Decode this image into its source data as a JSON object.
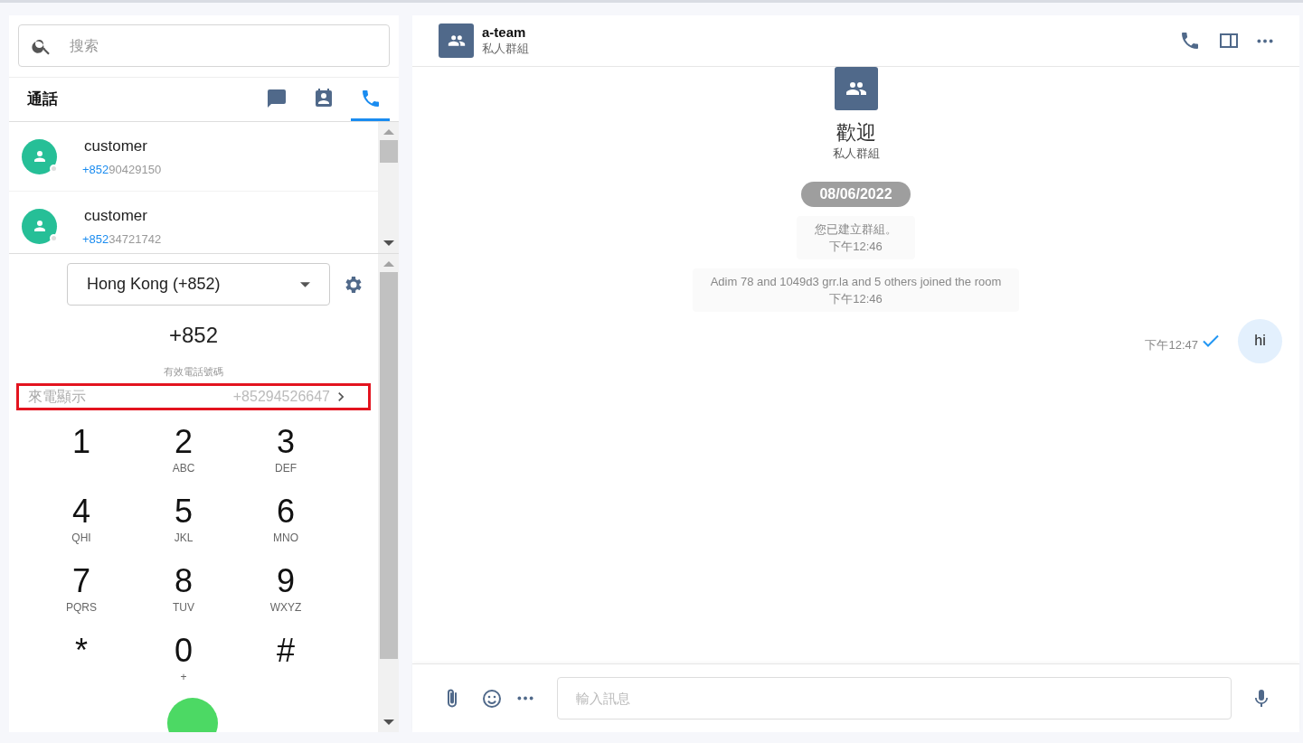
{
  "sidebar": {
    "search": {
      "placeholder": "搜索"
    },
    "title": "通話",
    "tabs": [
      {
        "kind": "chats",
        "selected": false
      },
      {
        "kind": "contacts",
        "selected": false
      },
      {
        "kind": "calls",
        "selected": true
      }
    ],
    "calls": [
      {
        "name": "customer",
        "code": "+852",
        "number": "90429150",
        "online": false
      },
      {
        "name": "customer",
        "code": "+852",
        "number": "34721742",
        "online": false
      }
    ],
    "dialer": {
      "country": "Hong Kong (+852)",
      "entered": "+852",
      "hint": "有效電話號碼",
      "caller_id": {
        "label": "來電顯示",
        "value": "+85294526647",
        "highlighted": true
      },
      "keys": [
        {
          "digit": "1"
        },
        {
          "digit": "2",
          "letters": "ABC"
        },
        {
          "digit": "3",
          "letters": "DEF"
        },
        {
          "digit": "4",
          "letters": "QHI"
        },
        {
          "digit": "5",
          "letters": "JKL"
        },
        {
          "digit": "6",
          "letters": "MNO"
        },
        {
          "digit": "7",
          "letters": "PQRS"
        },
        {
          "digit": "8",
          "letters": "TUV"
        },
        {
          "digit": "9",
          "letters": "WXYZ"
        },
        {
          "digit": "*"
        },
        {
          "digit": "0",
          "letters": "+"
        },
        {
          "digit": "#"
        }
      ]
    }
  },
  "room": {
    "name": "a-team",
    "subtitle": "私人群組",
    "welcome": "歡迎",
    "welcome_subtitle": "私人群組",
    "messages": [
      {
        "kind": "date",
        "text": "08/06/2022"
      },
      {
        "kind": "system",
        "text": "您已建立群組。",
        "time": "下午12:46"
      },
      {
        "kind": "system",
        "text": "Adim 78 and 1049d3 grr.la and 5 others joined the room",
        "time": "下午12:46"
      },
      {
        "kind": "outgoing",
        "text": "hi",
        "time": "下午12:47",
        "read": true
      }
    ],
    "composer": {
      "placeholder": "輸入訊息"
    }
  }
}
